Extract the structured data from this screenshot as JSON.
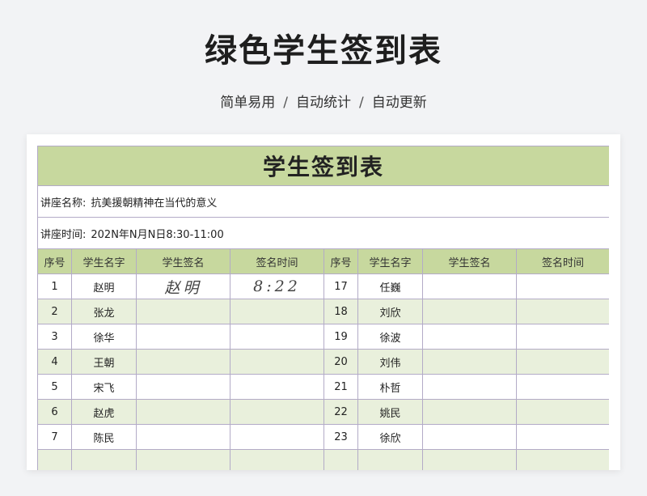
{
  "page": {
    "main_title": "绿色学生签到表",
    "subtitle_items": [
      "简单易用",
      "自动统计",
      "自动更新"
    ],
    "subtitle_sep": "/"
  },
  "sheet": {
    "title": "学生签到表",
    "lecture_name_label": "讲座名称:",
    "lecture_name": "抗美援朝精神在当代的意义",
    "lecture_time_label": "讲座时间:",
    "lecture_time": "202N年N月N日8:30-11:00",
    "headers": [
      "序号",
      "学生名字",
      "学生签名",
      "签名时间",
      "序号",
      "学生名字",
      "学生签名",
      "签名时间"
    ],
    "rows": [
      {
        "left_no": "1",
        "left_name": "赵明",
        "left_sign": "赵明",
        "left_time": "8:22",
        "right_no": "17",
        "right_name": "任巍",
        "right_sign": "",
        "right_time": ""
      },
      {
        "left_no": "2",
        "left_name": "张龙",
        "left_sign": "",
        "left_time": "",
        "right_no": "18",
        "right_name": "刘欣",
        "right_sign": "",
        "right_time": ""
      },
      {
        "left_no": "3",
        "left_name": "徐华",
        "left_sign": "",
        "left_time": "",
        "right_no": "19",
        "right_name": "徐波",
        "right_sign": "",
        "right_time": ""
      },
      {
        "left_no": "4",
        "left_name": "王朝",
        "left_sign": "",
        "left_time": "",
        "right_no": "20",
        "right_name": "刘伟",
        "right_sign": "",
        "right_time": ""
      },
      {
        "left_no": "5",
        "left_name": "宋飞",
        "left_sign": "",
        "left_time": "",
        "right_no": "21",
        "right_name": "朴哲",
        "right_sign": "",
        "right_time": ""
      },
      {
        "left_no": "6",
        "left_name": "赵虎",
        "left_sign": "",
        "left_time": "",
        "right_no": "22",
        "right_name": "姚民",
        "right_sign": "",
        "right_time": ""
      },
      {
        "left_no": "7",
        "left_name": "陈民",
        "left_sign": "",
        "left_time": "",
        "right_no": "23",
        "right_name": "徐欣",
        "right_sign": "",
        "right_time": ""
      },
      {
        "left_no": "",
        "left_name": "",
        "left_sign": "",
        "left_time": "",
        "right_no": "",
        "right_name": "",
        "right_sign": "",
        "right_time": ""
      }
    ]
  },
  "colors": {
    "header_green": "#c7d89e",
    "row_alt_green": "#e9f0dc",
    "grid_line": "#b3abc7"
  }
}
